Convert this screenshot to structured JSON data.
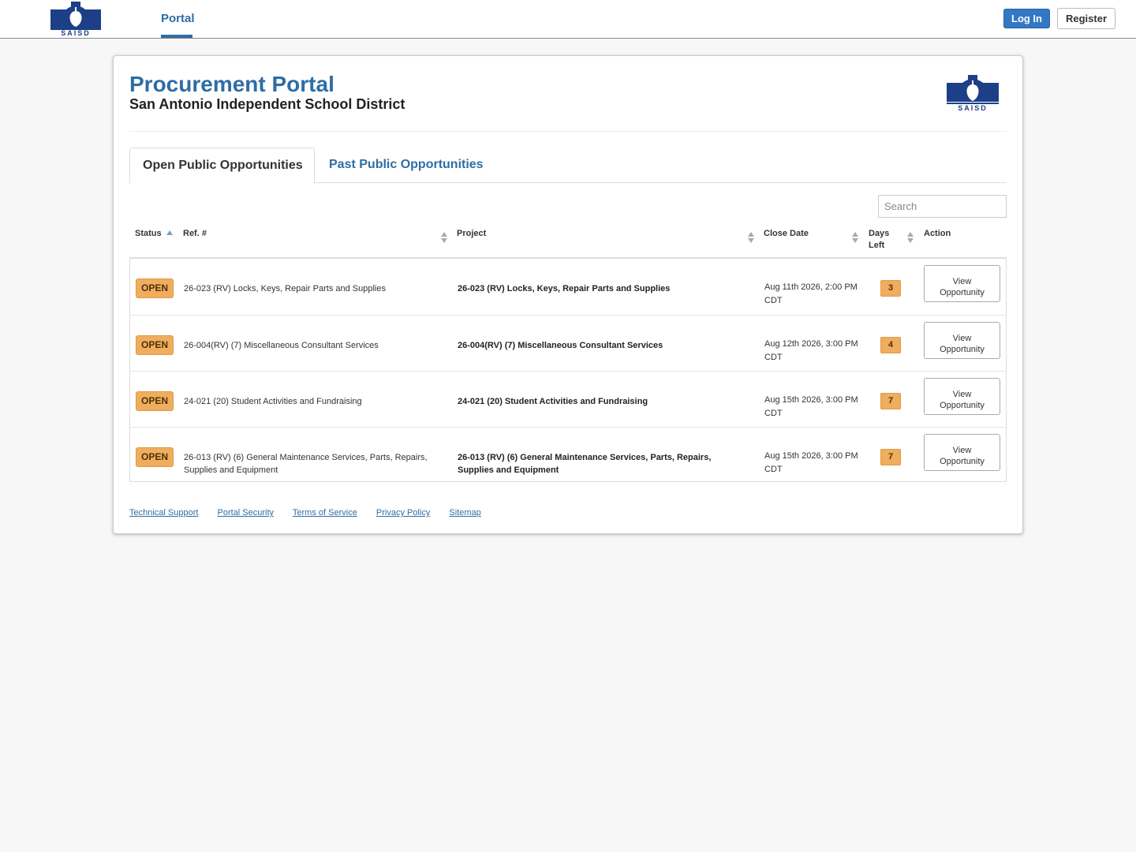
{
  "header": {
    "logo_text": "SAISD",
    "nav_portal": "Portal",
    "login_label": "Log In",
    "register_label": "Register"
  },
  "page": {
    "title": "Procurement Portal",
    "subtitle": "San Antonio Independent School District",
    "logo_text": "SAISD"
  },
  "tabs": {
    "open": "Open Public Opportunities",
    "past": "Past Public Opportunities"
  },
  "search": {
    "placeholder": "Search",
    "value": ""
  },
  "table": {
    "headers": {
      "status": "Status",
      "ref": "Ref. #",
      "project": "Project",
      "close_date": "Close Date",
      "days_left_1": "Days",
      "days_left_2": "Left",
      "action": "Action"
    },
    "rows": [
      {
        "status": "OPEN",
        "ref": "26-023 (RV) Locks, Keys, Repair Parts and Supplies",
        "project": "26-023 (RV) Locks, Keys, Repair Parts and Supplies",
        "close_date": "Aug 11th 2026, 2:00 PM CDT",
        "days_left": "3",
        "action_1": "View",
        "action_2": "Opportunity"
      },
      {
        "status": "OPEN",
        "ref": "26-004(RV) (7) Miscellaneous Consultant Services",
        "project": "26-004(RV) (7) Miscellaneous Consultant Services",
        "close_date": "Aug 12th 2026, 3:00 PM CDT",
        "days_left": "4",
        "action_1": "View",
        "action_2": "Opportunity"
      },
      {
        "status": "OPEN",
        "ref": "24-021 (20) Student Activities and Fundraising",
        "project": "24-021 (20) Student Activities and Fundraising",
        "close_date": "Aug 15th 2026, 3:00 PM CDT",
        "days_left": "7",
        "action_1": "View",
        "action_2": "Opportunity"
      },
      {
        "status": "OPEN",
        "ref": "26-013 (RV) (6) General Maintenance Services, Parts, Repairs, Supplies and Equipment",
        "project": "26-013 (RV) (6) General Maintenance Services, Parts, Repairs, Supplies and Equipment",
        "close_date": "Aug 15th 2026, 3:00 PM CDT",
        "days_left": "7",
        "action_1": "View",
        "action_2": "Opportunity"
      }
    ]
  },
  "footer": {
    "links": [
      "Technical Support",
      "Portal Security",
      "Terms of Service",
      "Privacy Policy",
      "Sitemap"
    ]
  },
  "colors": {
    "brand_blue": "#2e6da4",
    "logo_navy": "#1d3f87",
    "badge_orange": "#f0ad5e",
    "login_blue": "#3278c5"
  }
}
